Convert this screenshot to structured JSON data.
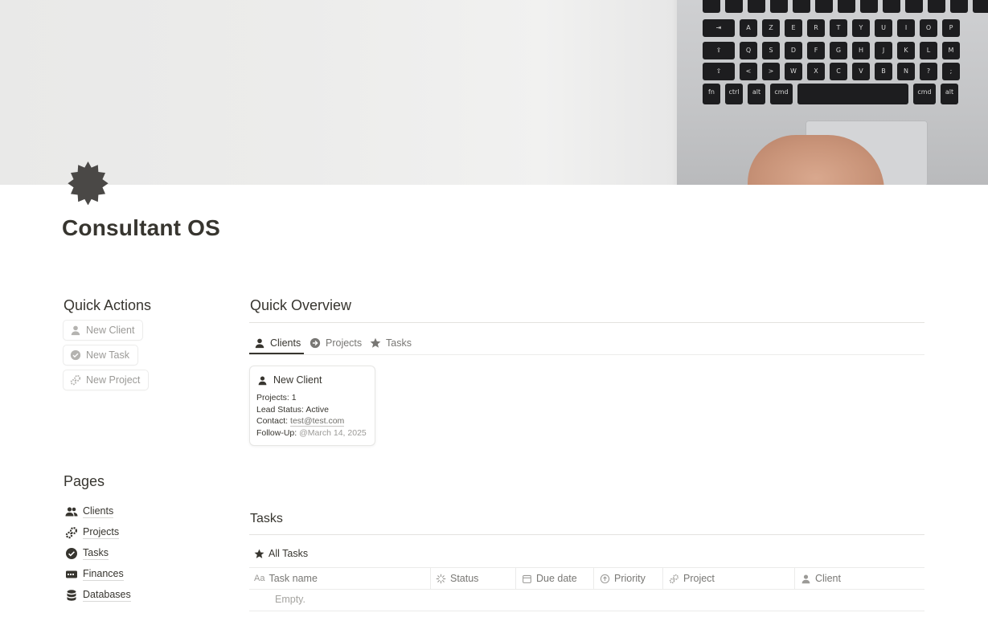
{
  "page": {
    "title": "Consultant OS",
    "icon": "starburst-badge-icon"
  },
  "cover": {
    "keyboard_keys": [
      [
        "⇥",
        "A",
        "Z",
        "E",
        "R",
        "T",
        "Y",
        "U",
        "I",
        "O",
        "P"
      ],
      [
        "⇪",
        "Q",
        "S",
        "D",
        "F",
        "G",
        "H",
        "J",
        "K",
        "L",
        "M"
      ],
      [
        "⇧",
        "<",
        ">",
        "W",
        "X",
        "C",
        "V",
        "B",
        "N",
        "?",
        ";"
      ]
    ],
    "bottom_keys": [
      "fn",
      "ctrl",
      "alt",
      "cmd",
      "",
      "cmd",
      "alt"
    ]
  },
  "quick_actions": {
    "heading": "Quick Actions",
    "buttons": [
      {
        "label": "New Client",
        "icon": "person-icon"
      },
      {
        "label": "New Task",
        "icon": "check-circle-icon"
      },
      {
        "label": "New Project",
        "icon": "gears-icon"
      }
    ]
  },
  "pages_section": {
    "heading": "Pages",
    "links": [
      {
        "label": "Clients",
        "icon": "people-icon"
      },
      {
        "label": "Projects",
        "icon": "gears-icon"
      },
      {
        "label": "Tasks",
        "icon": "check-circle-icon"
      },
      {
        "label": "Finances",
        "icon": "money-icon"
      },
      {
        "label": "Databases",
        "icon": "database-icon"
      }
    ]
  },
  "overview": {
    "heading": "Quick Overview",
    "tabs": [
      {
        "label": "Clients",
        "icon": "person-icon",
        "active": true
      },
      {
        "label": "Projects",
        "icon": "arrow-circle-icon",
        "active": false
      },
      {
        "label": "Tasks",
        "icon": "star-icon",
        "active": false
      }
    ],
    "card": {
      "title": "New Client",
      "projects_label": "Projects:",
      "projects_value": "1",
      "lead_status_label": "Lead Status:",
      "lead_status_value": "Active",
      "contact_label": "Contact:",
      "contact_value": "test@test.com",
      "followup_label": "Follow-Up:",
      "followup_at": "@",
      "followup_value": "March 14, 2025"
    }
  },
  "tasks": {
    "heading": "Tasks",
    "view_label": "All Tasks",
    "columns": [
      {
        "label": "Task name",
        "icon": "text-aa-icon"
      },
      {
        "label": "Status",
        "icon": "status-spinner-icon"
      },
      {
        "label": "Due date",
        "icon": "calendar-icon"
      },
      {
        "label": "Priority",
        "icon": "priority-circle-icon"
      },
      {
        "label": "Project",
        "icon": "relation-icon"
      },
      {
        "label": "Client",
        "icon": "person-icon"
      }
    ],
    "empty_text": "Empty."
  }
}
